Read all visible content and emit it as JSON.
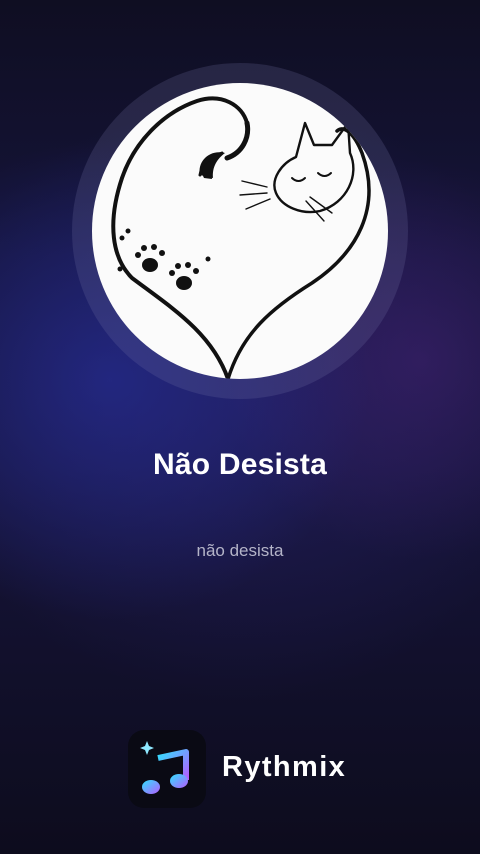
{
  "song": {
    "title": "Não Desista",
    "subtitle": "não desista"
  },
  "brand": {
    "name": "Rythmix",
    "icon": "music-note-icon"
  },
  "artwork": {
    "icon": "cat-heart-artwork"
  },
  "colors": {
    "background_top": "#0f0e22",
    "background_glow": "#2a32aa",
    "title": "#ffffff",
    "subtitle": "#b4b4c8",
    "note_gradient_start": "#2fe2ff",
    "note_gradient_end": "#b45cff"
  }
}
